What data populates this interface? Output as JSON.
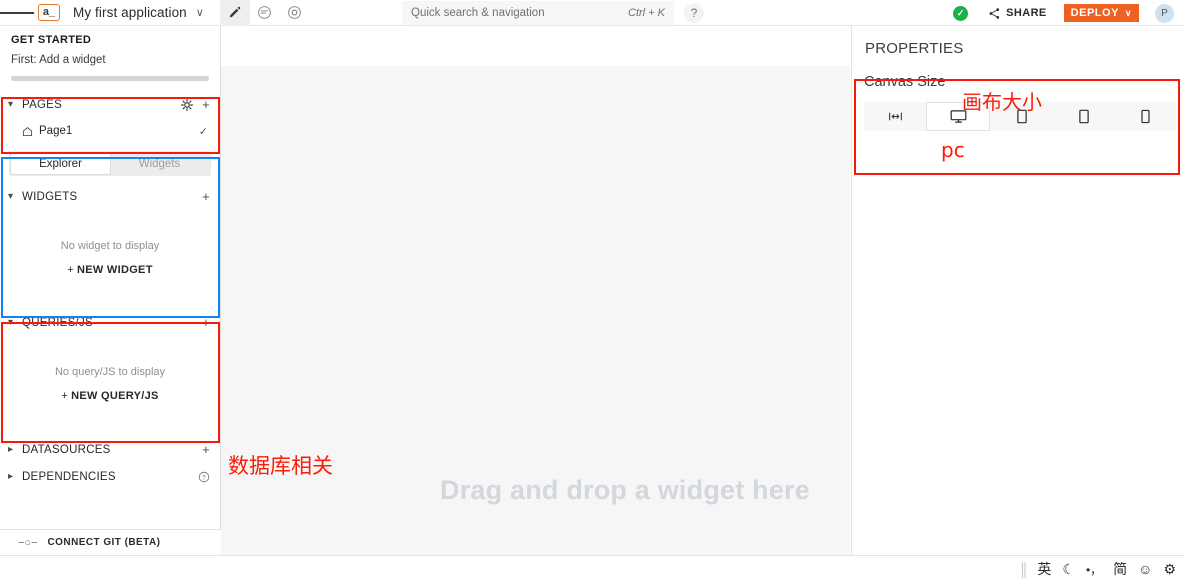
{
  "header": {
    "menu_icon": "hamburger-icon",
    "app_badge": "a_",
    "app_title": "My first application",
    "app_title_caret": "∨",
    "tools": [
      {
        "name": "edit-pencil",
        "glyph": "pencil-icon",
        "active": true
      },
      {
        "name": "comment",
        "glyph": "comment-icon",
        "active": false
      },
      {
        "name": "preview-eye",
        "glyph": "eye-icon",
        "active": false
      }
    ],
    "search": {
      "placeholder": "Quick search & navigation",
      "shortcut": "Ctrl + K"
    },
    "help_label": "?",
    "status_check": "✓",
    "share_label": "SHARE",
    "deploy_label": "DEPLOY",
    "deploy_caret": "∨",
    "avatar_initial": "P",
    "deploy_color": "#ef6122",
    "status_color": "#19b34c"
  },
  "sidebar": {
    "get_started_title": "GET STARTED",
    "get_started_step": "First: Add a widget",
    "pages": {
      "label": "PAGES",
      "settings_icon": "gear-icon",
      "add_icon": "+",
      "items": [
        {
          "label": "Page1",
          "icon": "home-icon",
          "selected_mark": "✓"
        }
      ]
    },
    "tabs": [
      {
        "label": "Explorer",
        "active": true
      },
      {
        "label": "Widgets",
        "active": false
      }
    ],
    "widgets": {
      "label": "WIDGETS",
      "add_icon": "+",
      "empty_message": "No widget to display",
      "cta_plus": "+",
      "cta_label": "NEW WIDGET"
    },
    "queries": {
      "label": "QUERIES/JS",
      "add_icon": "+",
      "empty_message": "No query/JS to display",
      "cta_plus": "+",
      "cta_label": "NEW QUERY/JS"
    },
    "datasources": {
      "label": "DATASOURCES",
      "add_icon": "+"
    },
    "dependencies": {
      "label": "DEPENDENCIES",
      "help_icon": "?"
    },
    "git": {
      "icon": "branch-icon",
      "label": "CONNECT GIT (BETA)"
    }
  },
  "canvas": {
    "drop_hint": "Drag and drop a widget here"
  },
  "properties": {
    "title": "PROPERTIES",
    "canvas_size_label": "Canvas Size",
    "size_options": [
      {
        "name": "fluid",
        "icon": "fluid-width-icon",
        "active": false
      },
      {
        "name": "desktop",
        "icon": "desktop-icon",
        "active": true
      },
      {
        "name": "tablet-large",
        "icon": "tablet-icon",
        "active": false
      },
      {
        "name": "tablet",
        "icon": "tablet-icon",
        "active": false
      },
      {
        "name": "mobile",
        "icon": "mobile-icon",
        "active": false
      }
    ]
  },
  "annotations": {
    "color": "#f61a0a",
    "blue_color": "#1184f0",
    "canvas_size_cn": "画布大小",
    "pc_label": "pc",
    "database_cn": "数据库相关"
  },
  "taskbar": {
    "ime_items": [
      "英",
      "☾",
      "•，",
      "简",
      "☺",
      "⚙"
    ]
  }
}
